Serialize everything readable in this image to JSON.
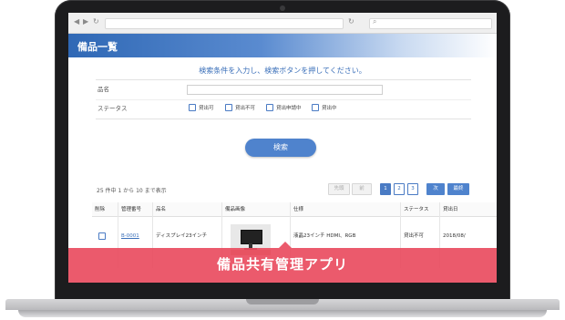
{
  "window": {
    "nav_back_icon": "chevron-left-icon",
    "nav_forward_icon": "chevron-right-icon",
    "search_icon": "search-icon"
  },
  "header": {
    "title": "備品一覧"
  },
  "instruction": "検索条件を入力し、検索ボタンを押してください。",
  "filter": {
    "name_label": "品名",
    "name_value": "",
    "status_label": "ステータス",
    "status_options": [
      "貸出可",
      "貸出不可",
      "貸出申請中",
      "貸出中"
    ]
  },
  "search_button": "検索",
  "results": {
    "count_text": "25 件中 1 から 10 まで表示",
    "pager": {
      "first": "先頭",
      "prev": "前",
      "pages": [
        "1",
        "2",
        "3"
      ],
      "next": "次",
      "last": "最終",
      "current": "1"
    }
  },
  "table": {
    "headers": [
      "削除",
      "管理番号",
      "品名",
      "備品画像",
      "仕様",
      "ステータス",
      "貸出日"
    ],
    "rows": [
      {
        "id": "B-0001",
        "name": "ディスプレイ23インチ",
        "image": "monitor-photo",
        "spec": "液晶23インチ HDMI、RGB",
        "status": "貸出不可",
        "date": "2018/08/"
      }
    ]
  },
  "banner": {
    "text": "備品共有管理アプリ",
    "color": "#e94c60"
  },
  "colors": {
    "accent": "#4f83cd",
    "link": "#3a6fb9"
  }
}
